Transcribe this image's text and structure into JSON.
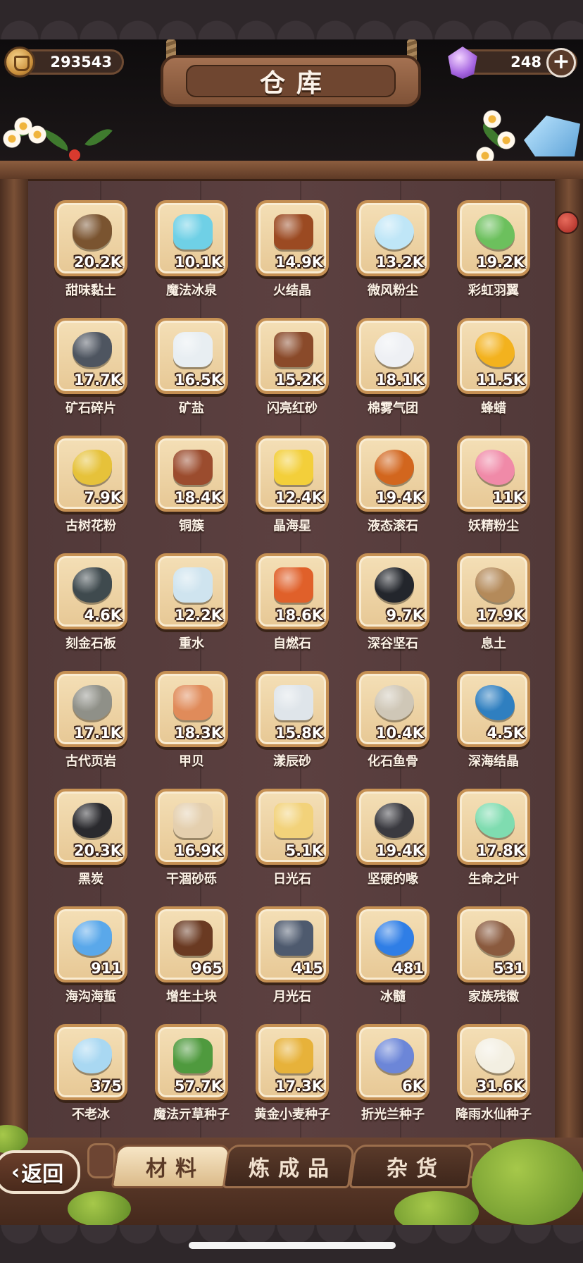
{
  "header": {
    "title": "仓库",
    "gold": "293543",
    "gems": "248"
  },
  "items": [
    {
      "name": "甜味黏土",
      "count": "20.2K",
      "icon": "clay-icon",
      "color": "#7a5430"
    },
    {
      "name": "魔法冰泉",
      "count": "10.1K",
      "icon": "ice-spring-icon",
      "color": "#6fd0e6"
    },
    {
      "name": "火结晶",
      "count": "14.9K",
      "icon": "fire-crystal-icon",
      "color": "#9b4a22"
    },
    {
      "name": "微风粉尘",
      "count": "13.2K",
      "icon": "breeze-dust-icon",
      "color": "#bfe6f7"
    },
    {
      "name": "彩虹羽翼",
      "count": "19.2K",
      "icon": "rainbow-wing-icon",
      "color": "#6cc05d"
    },
    {
      "name": "矿石碎片",
      "count": "17.7K",
      "icon": "ore-shard-icon",
      "color": "#4e5560"
    },
    {
      "name": "矿盐",
      "count": "16.5K",
      "icon": "rock-salt-icon",
      "color": "#e8eef2"
    },
    {
      "name": "闪亮红砂",
      "count": "15.2K",
      "icon": "red-sand-icon",
      "color": "#8a4a2a"
    },
    {
      "name": "棉雾气团",
      "count": "18.1K",
      "icon": "cotton-mist-icon",
      "color": "#eef0f4"
    },
    {
      "name": "蜂蜡",
      "count": "11.5K",
      "icon": "beeswax-icon",
      "color": "#f3b21e"
    },
    {
      "name": "古树花粉",
      "count": "7.9K",
      "icon": "pollen-icon",
      "color": "#e6c23a"
    },
    {
      "name": "铜簇",
      "count": "18.4K",
      "icon": "copper-cluster-icon",
      "color": "#9b4c2e"
    },
    {
      "name": "晶海星",
      "count": "12.4K",
      "icon": "star-icon",
      "color": "#f3cf3a"
    },
    {
      "name": "液态滚石",
      "count": "19.4K",
      "icon": "lava-rock-icon",
      "color": "#d2661e"
    },
    {
      "name": "妖精粉尘",
      "count": "11K",
      "icon": "fairy-dust-jar-icon",
      "color": "#f08aa8"
    },
    {
      "name": "刻金石板",
      "count": "4.6K",
      "icon": "stone-tablet-icon",
      "color": "#3f4a4e"
    },
    {
      "name": "重水",
      "count": "12.2K",
      "icon": "heavy-water-icon",
      "color": "#cfe4ef"
    },
    {
      "name": "自燃石",
      "count": "18.6K",
      "icon": "burning-stone-icon",
      "color": "#e0602a"
    },
    {
      "name": "深谷坚石",
      "count": "9.7K",
      "icon": "hard-stone-icon",
      "color": "#23262c"
    },
    {
      "name": "息土",
      "count": "17.9K",
      "icon": "soil-icon",
      "color": "#b48a5a"
    },
    {
      "name": "古代页岩",
      "count": "17.1K",
      "icon": "shale-icon",
      "color": "#8f9088"
    },
    {
      "name": "甲贝",
      "count": "18.3K",
      "icon": "shell-icon",
      "color": "#e08b5a"
    },
    {
      "name": "漾辰砂",
      "count": "15.8K",
      "icon": "crystal-sand-icon",
      "color": "#dfe5ea"
    },
    {
      "name": "化石鱼骨",
      "count": "10.4K",
      "icon": "fish-fossil-icon",
      "color": "#cfc7b7"
    },
    {
      "name": "深海结晶",
      "count": "4.5K",
      "icon": "deep-sea-crystal-icon",
      "color": "#2f7fc0"
    },
    {
      "name": "黑炭",
      "count": "20.3K",
      "icon": "charcoal-icon",
      "color": "#2a2a2e"
    },
    {
      "name": "干涸砂砾",
      "count": "16.9K",
      "icon": "gravel-icon",
      "color": "#e4cfae"
    },
    {
      "name": "日光石",
      "count": "5.1K",
      "icon": "sunstone-icon",
      "color": "#f2d27a"
    },
    {
      "name": "坚硬的喙",
      "count": "19.4K",
      "icon": "beak-icon",
      "color": "#3a3a40"
    },
    {
      "name": "生命之叶",
      "count": "17.8K",
      "icon": "life-leaf-icon",
      "color": "#7fdcb0"
    },
    {
      "name": "海沟海蜇",
      "count": "911",
      "icon": "jellyfish-icon",
      "color": "#5aa8ea"
    },
    {
      "name": "增生土块",
      "count": "965",
      "icon": "dirt-clod-icon",
      "color": "#6a3a22"
    },
    {
      "name": "月光石",
      "count": "415",
      "icon": "moonstone-icon",
      "color": "#4e5a6e"
    },
    {
      "name": "冰髓",
      "count": "481",
      "icon": "ice-marrow-icon",
      "color": "#2f7ee6"
    },
    {
      "name": "家族残徽",
      "count": "531",
      "icon": "broken-crest-icon",
      "color": "#8a5a3e"
    },
    {
      "name": "不老冰",
      "count": "375",
      "icon": "ageless-ice-icon",
      "color": "#a9d8f2"
    },
    {
      "name": "魔法亓草种子",
      "count": "57.7K",
      "icon": "herb-seed-icon",
      "color": "#4f9a3e"
    },
    {
      "name": "黄金小麦种子",
      "count": "17.3K",
      "icon": "wheat-seed-icon",
      "color": "#e7b23a"
    },
    {
      "name": "折光兰种子",
      "count": "6K",
      "icon": "orchid-seed-icon",
      "color": "#6c86d8"
    },
    {
      "name": "降雨水仙种子",
      "count": "31.6K",
      "icon": "narcissus-seed-icon",
      "color": "#f3efe2"
    }
  ],
  "tabs": [
    {
      "label": "材料",
      "active": true
    },
    {
      "label": "炼成品",
      "active": false
    },
    {
      "label": "杂货",
      "active": false
    }
  ],
  "back_label": "返回"
}
